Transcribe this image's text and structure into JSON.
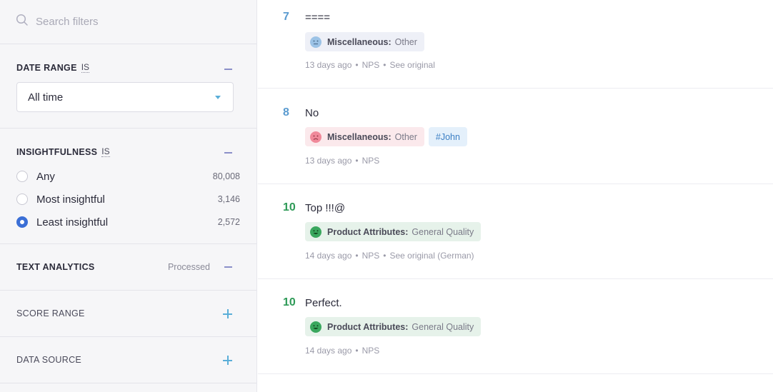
{
  "sidebar": {
    "search": {
      "placeholder": "Search filters"
    },
    "date_range": {
      "title": "DATE RANGE",
      "operator": "IS",
      "selected": "All time"
    },
    "insightfulness": {
      "title": "INSIGHTFULNESS",
      "operator": "IS",
      "options": [
        {
          "label": "Any",
          "count": "80,008",
          "checked": false
        },
        {
          "label": "Most insightful",
          "count": "3,146",
          "checked": false
        },
        {
          "label": "Least insightful",
          "count": "2,572",
          "checked": true
        }
      ]
    },
    "text_analytics": {
      "title": "TEXT ANALYTICS",
      "status": "Processed"
    },
    "score_range": {
      "title": "SCORE RANGE"
    },
    "data_source": {
      "title": "DATA SOURCE"
    }
  },
  "feed": {
    "items": [
      {
        "score": "7",
        "score_color": "#5a9bd0",
        "comment": "====",
        "tags": [
          {
            "category": "Miscellaneous:",
            "value": "Other",
            "sentiment": "neutral"
          }
        ],
        "meta": {
          "age": "13 days ago",
          "source": "NPS",
          "link": "See original"
        }
      },
      {
        "score": "8",
        "score_color": "#5a9bd0",
        "comment": "No",
        "tags": [
          {
            "category": "Miscellaneous:",
            "value": "Other",
            "sentiment": "negative"
          }
        ],
        "hashtag": "#John",
        "meta": {
          "age": "13 days ago",
          "source": "NPS"
        }
      },
      {
        "score": "10",
        "score_color": "#2e9a57",
        "comment": "Top !!!@",
        "tags": [
          {
            "category": "Product Attributes:",
            "value": "General Quality",
            "sentiment": "positive"
          }
        ],
        "meta": {
          "age": "14 days ago",
          "source": "NPS",
          "link": "See original (German)"
        }
      },
      {
        "score": "10",
        "score_color": "#2e9a57",
        "comment": "Perfect.",
        "tags": [
          {
            "category": "Product Attributes:",
            "value": "General Quality",
            "sentiment": "positive"
          }
        ],
        "meta": {
          "age": "14 days ago",
          "source": "NPS"
        }
      }
    ]
  },
  "colors": {
    "accent_blue": "#3b6fd6",
    "neutral_tag_bg": "#eef0f7",
    "negative_tag_bg": "#fbe9ec",
    "positive_tag_bg": "#e6f2ea"
  },
  "icons": {
    "search": "search-icon",
    "collapse": "minus-icon",
    "expand": "plus-icon",
    "dropdown": "caret-down-icon",
    "neutral_face": "neutral-face-icon",
    "sad_face": "sad-face-icon",
    "happy_face": "happy-face-icon"
  }
}
